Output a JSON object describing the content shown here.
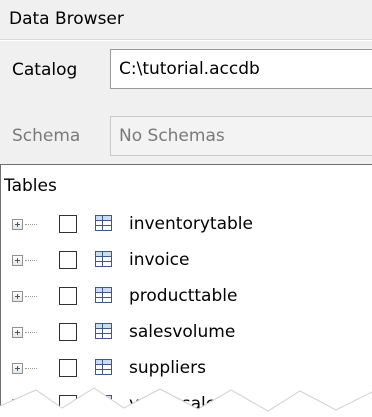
{
  "panel": {
    "title": "Data Browser"
  },
  "catalog": {
    "label": "Catalog",
    "value": "C:\\tutorial.accdb"
  },
  "schema": {
    "label": "Schema",
    "value": "No Schemas"
  },
  "tables": {
    "header": "Tables",
    "items": [
      {
        "label": "inventorytable",
        "icon": "table-icon",
        "checked": false
      },
      {
        "label": "invoice",
        "icon": "table-icon",
        "checked": false
      },
      {
        "label": "producttable",
        "icon": "table-icon",
        "checked": false
      },
      {
        "label": "salesvolume",
        "icon": "table-icon",
        "checked": false
      },
      {
        "label": "suppliers",
        "icon": "table-icon",
        "checked": false
      },
      {
        "label": "yearlysales",
        "icon": "table-icon",
        "checked": false
      }
    ]
  },
  "colors": {
    "panel_background": "#f0f0f0",
    "icon_blue": "#3d5a86",
    "disabled_text": "#7a7a7a"
  }
}
